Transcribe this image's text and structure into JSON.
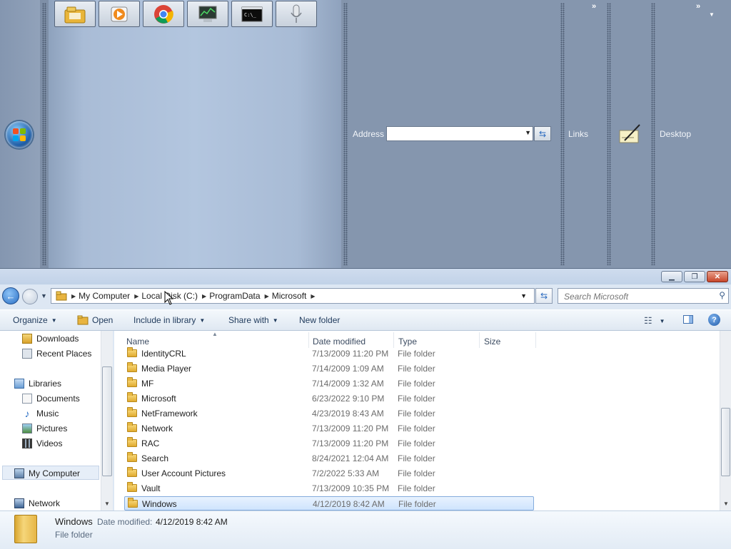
{
  "taskbar": {
    "quick_launch": [
      {
        "name": "explorer-icon"
      },
      {
        "name": "media-player-icon"
      },
      {
        "name": "chrome-icon"
      },
      {
        "name": "task-manager-icon"
      },
      {
        "name": "command-prompt-icon"
      },
      {
        "name": "microphone-icon"
      }
    ],
    "address_label": "Address",
    "address_value": "",
    "links_label": "Links",
    "desktop_label": "Desktop",
    "chevron": "»"
  },
  "explorer": {
    "breadcrumb": [
      "My Computer",
      "Local Disk (C:)",
      "ProgramData",
      "Microsoft"
    ],
    "search_placeholder": "Search Microsoft",
    "toolbar": {
      "organize": "Organize",
      "open": "Open",
      "include_in_library": "Include in library",
      "share_with": "Share with",
      "new_folder": "New folder"
    },
    "nav": {
      "downloads": "Downloads",
      "recent_places": "Recent Places",
      "libraries": "Libraries",
      "documents": "Documents",
      "music": "Music",
      "pictures": "Pictures",
      "videos": "Videos",
      "my_computer": "My Computer",
      "network": "Network"
    },
    "columns": {
      "name": "Name",
      "date_modified": "Date modified",
      "type": "Type",
      "size": "Size"
    },
    "files": [
      {
        "name": "IdentityCRL",
        "date": "7/13/2009 11:20 PM",
        "type": "File folder"
      },
      {
        "name": "Media Player",
        "date": "7/14/2009 1:09 AM",
        "type": "File folder"
      },
      {
        "name": "MF",
        "date": "7/14/2009 1:32 AM",
        "type": "File folder"
      },
      {
        "name": "Microsoft",
        "date": "6/23/2022 9:10 PM",
        "type": "File folder"
      },
      {
        "name": "NetFramework",
        "date": "4/23/2019 8:43 AM",
        "type": "File folder"
      },
      {
        "name": "Network",
        "date": "7/13/2009 11:20 PM",
        "type": "File folder"
      },
      {
        "name": "RAC",
        "date": "7/13/2009 11:20 PM",
        "type": "File folder"
      },
      {
        "name": "Search",
        "date": "8/24/2021 12:04 AM",
        "type": "File folder"
      },
      {
        "name": "User Account Pictures",
        "date": "7/2/2022 5:33 AM",
        "type": "File folder"
      },
      {
        "name": "Vault",
        "date": "7/13/2009 10:35 PM",
        "type": "File folder"
      },
      {
        "name": "Windows",
        "date": "4/12/2019 8:42 AM",
        "type": "File folder",
        "selected": true
      }
    ],
    "details": {
      "name": "Windows",
      "date_label": "Date modified:",
      "date_value": "4/12/2019 8:42 AM",
      "type": "File folder"
    }
  },
  "colors": {
    "selection_border": "#84acdd",
    "taskbar": "#8596ae",
    "accent": "#2a6fc4"
  }
}
